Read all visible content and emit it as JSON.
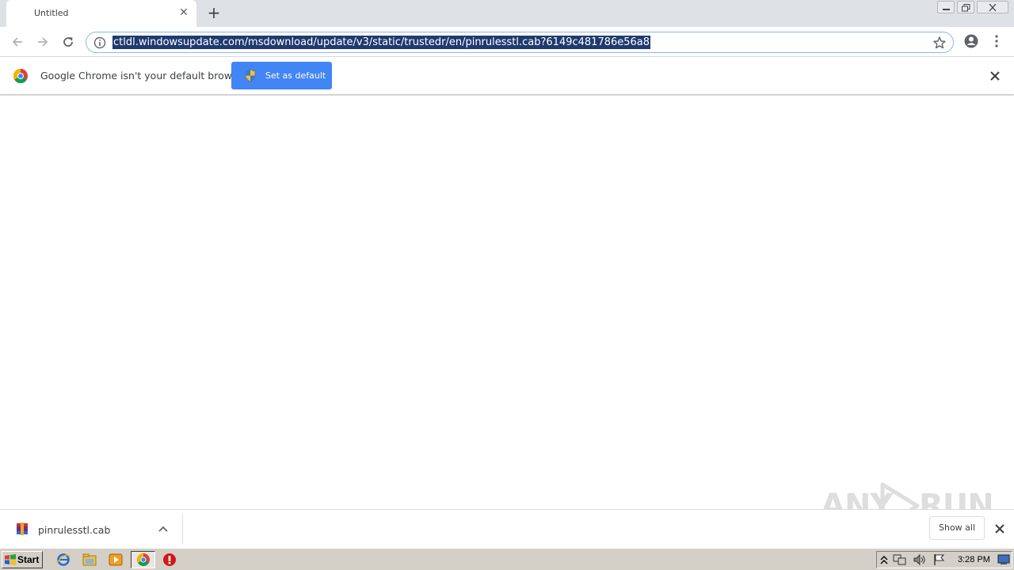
{
  "tab": {
    "title": "Untitled"
  },
  "omnibox": {
    "url": "ctldl.windowsupdate.com/msdownload/update/v3/static/trustedr/en/pinrulesstl.cab?6149c481786e56a8"
  },
  "infobar": {
    "message": "Google Chrome isn't your default browser",
    "button_label": "Set as default"
  },
  "download_shelf": {
    "filename": "pinrulesstl.cab",
    "show_all_label": "Show all"
  },
  "taskbar": {
    "start_label": "Start",
    "clock": "3:28 PM"
  },
  "watermark": {
    "left": "ANY",
    "right": "RUN"
  },
  "colors": {
    "accent_button": "#4285f4",
    "url_selection": "#1f3a6e",
    "tab_strip": "#dee1e6",
    "taskbar": "#d4d0c8"
  }
}
